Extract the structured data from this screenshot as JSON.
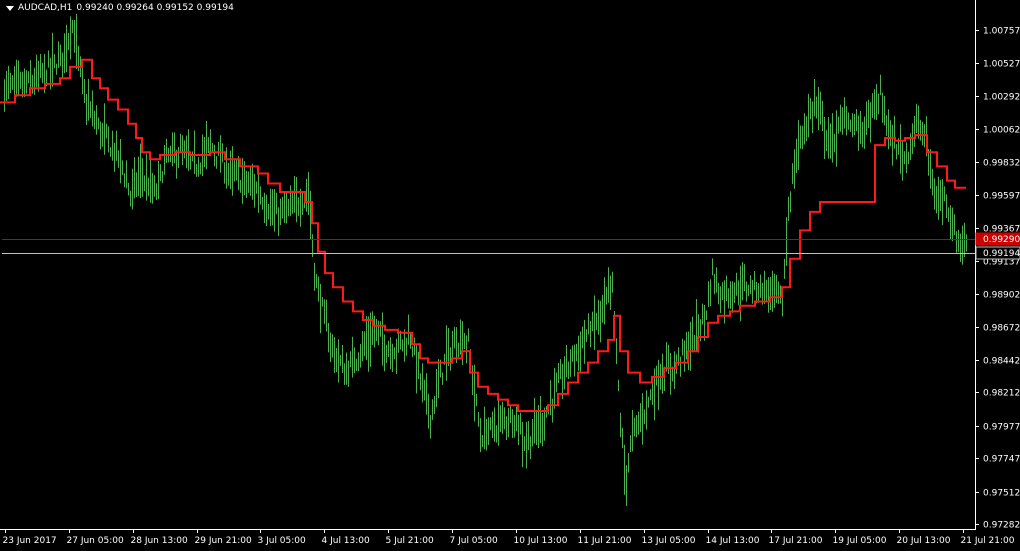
{
  "header": {
    "symbol": "AUDCAD,H1",
    "ohlc": "0.99240 0.99264 0.99152 0.99194"
  },
  "colors": {
    "background": "#000000",
    "bars": "#4caf50",
    "ma_line": "#ff1a1a",
    "axis": "#ffffff",
    "bid_line": "#c0c0c0",
    "ask_line": "#cc0000"
  },
  "chart_data": {
    "type": "bar",
    "instrument": "AUDCAD",
    "timeframe": "H1",
    "yticks": [
      "1.00757",
      "1.00527",
      "1.00292",
      "1.00062",
      "0.99832",
      "0.99597",
      "0.99367",
      "0.99137",
      "0.98902",
      "0.98672",
      "0.98442",
      "0.98212",
      "0.97977",
      "0.97747",
      "0.97512",
      "0.97282"
    ],
    "xticks": [
      "23 Jun 2017",
      "27 Jun 05:00",
      "28 Jun 13:00",
      "29 Jun 21:00",
      "3 Jul 05:00",
      "4 Jul 13:00",
      "5 Jul 21:00",
      "7 Jul 05:00",
      "10 Jul 13:00",
      "11 Jul 21:00",
      "13 Jul 05:00",
      "14 Jul 13:00",
      "17 Jul 21:00",
      "19 Jul 05:00",
      "20 Jul 13:00",
      "21 Jul 21:00"
    ],
    "ylim": [
      0.9725,
      1.009
    ],
    "price_tags": [
      {
        "name": "ask",
        "value": 0.9929,
        "label": "0.99290"
      },
      {
        "name": "bid",
        "value": 0.99194,
        "label": "0.99194"
      }
    ],
    "price_path": [
      [
        0,
        1.0035
      ],
      [
        30,
        1.0038
      ],
      [
        60,
        1.0055
      ],
      [
        72,
        1.008
      ],
      [
        85,
        1.0025
      ],
      [
        100,
        1.0005
      ],
      [
        120,
        0.9985
      ],
      [
        130,
        0.996
      ],
      [
        140,
        0.9975
      ],
      [
        155,
        0.996
      ],
      [
        165,
        0.9985
      ],
      [
        180,
        0.999
      ],
      [
        195,
        0.998
      ],
      [
        210,
        0.9995
      ],
      [
        230,
        0.9975
      ],
      [
        255,
        0.9965
      ],
      [
        275,
        0.9945
      ],
      [
        290,
        0.995
      ],
      [
        308,
        0.9962
      ],
      [
        315,
        0.99
      ],
      [
        330,
        0.9855
      ],
      [
        345,
        0.9835
      ],
      [
        360,
        0.985
      ],
      [
        375,
        0.9865
      ],
      [
        390,
        0.985
      ],
      [
        410,
        0.986
      ],
      [
        420,
        0.983
      ],
      [
        430,
        0.9805
      ],
      [
        445,
        0.9845
      ],
      [
        460,
        0.986
      ],
      [
        468,
        0.9855
      ],
      [
        480,
        0.979
      ],
      [
        500,
        0.98
      ],
      [
        515,
        0.9805
      ],
      [
        525,
        0.9785
      ],
      [
        545,
        0.9805
      ],
      [
        560,
        0.983
      ],
      [
        580,
        0.9855
      ],
      [
        600,
        0.9875
      ],
      [
        612,
        0.9895
      ],
      [
        620,
        0.98
      ],
      [
        625,
        0.976
      ],
      [
        632,
        0.979
      ],
      [
        645,
        0.981
      ],
      [
        660,
        0.9835
      ],
      [
        675,
        0.984
      ],
      [
        690,
        0.9855
      ],
      [
        705,
        0.9875
      ],
      [
        712,
        0.9905
      ],
      [
        720,
        0.989
      ],
      [
        740,
        0.9895
      ],
      [
        760,
        0.9895
      ],
      [
        775,
        0.989
      ],
      [
        782,
        0.9885
      ],
      [
        788,
        0.995
      ],
      [
        795,
        0.9985
      ],
      [
        805,
        1.001
      ],
      [
        815,
        1.0025
      ],
      [
        830,
        0.9995
      ],
      [
        845,
        1.0015
      ],
      [
        860,
        1.0005
      ],
      [
        870,
        1.0015
      ],
      [
        880,
        1.003
      ],
      [
        890,
        1.0
      ],
      [
        905,
        0.9985
      ],
      [
        915,
        1.001
      ],
      [
        925,
        1.0
      ],
      [
        935,
        0.9955
      ],
      [
        945,
        0.996
      ],
      [
        955,
        0.993
      ],
      [
        965,
        0.9925
      ]
    ],
    "ma_steps": [
      [
        0,
        1.0025
      ],
      [
        15,
        1.003
      ],
      [
        30,
        1.0035
      ],
      [
        45,
        1.0038
      ],
      [
        60,
        1.0042
      ],
      [
        70,
        1.005
      ],
      [
        82,
        1.0055
      ],
      [
        92,
        1.0042
      ],
      [
        100,
        1.0035
      ],
      [
        108,
        1.0027
      ],
      [
        118,
        1.002
      ],
      [
        128,
        1.001
      ],
      [
        136,
        1.0
      ],
      [
        142,
        0.999
      ],
      [
        150,
        0.9985
      ],
      [
        160,
        0.9988
      ],
      [
        175,
        0.999
      ],
      [
        190,
        0.9988
      ],
      [
        210,
        0.999
      ],
      [
        225,
        0.9985
      ],
      [
        240,
        0.998
      ],
      [
        258,
        0.9975
      ],
      [
        268,
        0.9968
      ],
      [
        280,
        0.9962
      ],
      [
        295,
        0.9962
      ],
      [
        305,
        0.9955
      ],
      [
        312,
        0.994
      ],
      [
        318,
        0.992
      ],
      [
        325,
        0.9905
      ],
      [
        333,
        0.9895
      ],
      [
        343,
        0.9885
      ],
      [
        353,
        0.9878
      ],
      [
        363,
        0.9872
      ],
      [
        373,
        0.9868
      ],
      [
        385,
        0.9865
      ],
      [
        398,
        0.9863
      ],
      [
        412,
        0.9855
      ],
      [
        420,
        0.9845
      ],
      [
        428,
        0.9842
      ],
      [
        440,
        0.9842
      ],
      [
        452,
        0.9845
      ],
      [
        462,
        0.985
      ],
      [
        470,
        0.9835
      ],
      [
        478,
        0.9825
      ],
      [
        488,
        0.982
      ],
      [
        498,
        0.9816
      ],
      [
        508,
        0.9812
      ],
      [
        518,
        0.9808
      ],
      [
        535,
        0.9808
      ],
      [
        548,
        0.9812
      ],
      [
        558,
        0.982
      ],
      [
        568,
        0.9828
      ],
      [
        578,
        0.9835
      ],
      [
        588,
        0.9842
      ],
      [
        598,
        0.985
      ],
      [
        608,
        0.9858
      ],
      [
        614,
        0.9875
      ],
      [
        620,
        0.985
      ],
      [
        628,
        0.9835
      ],
      [
        640,
        0.9828
      ],
      [
        652,
        0.9832
      ],
      [
        664,
        0.9838
      ],
      [
        676,
        0.9842
      ],
      [
        688,
        0.985
      ],
      [
        698,
        0.986
      ],
      [
        708,
        0.987
      ],
      [
        718,
        0.9875
      ],
      [
        730,
        0.9878
      ],
      [
        740,
        0.9882
      ],
      [
        755,
        0.9885
      ],
      [
        770,
        0.9888
      ],
      [
        782,
        0.9895
      ],
      [
        790,
        0.9915
      ],
      [
        800,
        0.9935
      ],
      [
        810,
        0.9948
      ],
      [
        820,
        0.9955
      ],
      [
        845,
        0.9955
      ],
      [
        870,
        0.9955
      ],
      [
        875,
        0.9995
      ],
      [
        885,
        1.0
      ],
      [
        895,
        0.9998
      ],
      [
        905,
        1.0
      ],
      [
        915,
        1.0002
      ],
      [
        927,
        0.999
      ],
      [
        937,
        0.998
      ],
      [
        947,
        0.997
      ],
      [
        955,
        0.9965
      ],
      [
        966,
        0.9965
      ]
    ]
  }
}
